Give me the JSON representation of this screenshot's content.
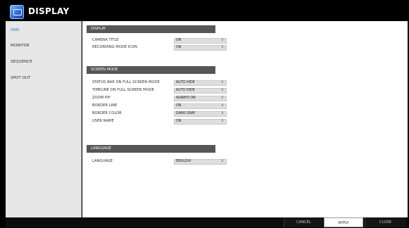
{
  "window": {
    "title": "DISPLAY"
  },
  "sidebar": {
    "items": [
      {
        "label": "OSD",
        "active": true
      },
      {
        "label": "MONITOR",
        "active": false
      },
      {
        "label": "SEQUENCE",
        "active": false
      },
      {
        "label": "SPOT OUT",
        "active": false
      }
    ]
  },
  "sections": {
    "display": {
      "header": "DISPLAY",
      "rows": [
        {
          "label": "CAMERA TITLE",
          "value": "ON"
        },
        {
          "label": "RECORDING MODE ICON",
          "value": "ON"
        }
      ]
    },
    "screen_mode": {
      "header": "SCREEN MODE",
      "rows": [
        {
          "label": "STATUS BAR ON FULL SCREEN MODE",
          "value": "AUTO HIDE"
        },
        {
          "label": "TIMELINE ON FULL SCREEN MODE",
          "value": "AUTO HIDE"
        },
        {
          "label": "ZOOM PIP",
          "value": "ALWAYS ON"
        },
        {
          "label": "BORDER LINE",
          "value": "ON"
        },
        {
          "label": "BORDER COLOR",
          "value": "DARK GRAY"
        },
        {
          "label": "USER NAME",
          "value": "ON"
        }
      ]
    },
    "language": {
      "header": "LANGUAGE",
      "rows": [
        {
          "label": "LANGUAGE",
          "value": "ENGLISH"
        }
      ]
    }
  },
  "select_caret": "⇕",
  "footer": {
    "cancel": "CANCEL",
    "apply": "APPLY",
    "close": "CLOSE"
  },
  "colors": {
    "accent": "#2e62b4",
    "section_header": "#565656",
    "select_bg": "#dedede"
  }
}
